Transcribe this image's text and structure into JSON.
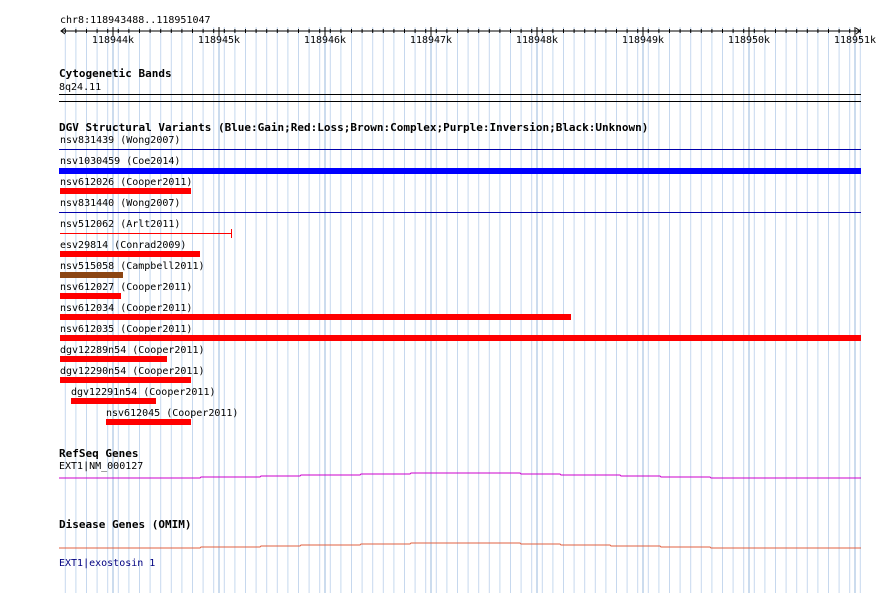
{
  "locus": "chr8:118943488..118951047",
  "ruler": {
    "ticks": [
      "118944k",
      "118945k",
      "118946k",
      "118947k",
      "118948k",
      "118949k",
      "118950k",
      "118951k"
    ]
  },
  "cytoband": {
    "title": "Cytogenetic Bands",
    "band": "8q24.11"
  },
  "dgv": {
    "title": "DGV Structural Variants (Blue:Gain;Red:Loss;Brown:Complex;Purple:Inversion;Black:Unknown)",
    "colors": {
      "gain": "#0000ff",
      "loss": "#ff0000",
      "complex": "#8b4513",
      "thin": "#0000aa"
    },
    "variants": [
      {
        "label": "nsv831439 (Wong2007)",
        "type": "thin"
      },
      {
        "label": "nsv1030459 (Coe2014)",
        "type": "gain"
      },
      {
        "label": "nsv612026 (Cooper2011)",
        "type": "loss"
      },
      {
        "label": "nsv831440 (Wong2007)",
        "type": "thin"
      },
      {
        "label": "nsv512062 (Arlt2011)",
        "type": "loss-thin"
      },
      {
        "label": "esv29814 (Conrad2009)",
        "type": "loss"
      },
      {
        "label": "nsv515058 (Campbell2011)",
        "type": "complex"
      },
      {
        "label": "nsv612027 (Cooper2011)",
        "type": "loss"
      },
      {
        "label": "nsv612034 (Cooper2011)",
        "type": "loss"
      },
      {
        "label": "nsv612035 (Cooper2011)",
        "type": "loss"
      },
      {
        "label": "dgv12289n54 (Cooper2011)",
        "type": "loss"
      },
      {
        "label": "dgv12290n54 (Cooper2011)",
        "type": "loss"
      },
      {
        "label": "dgv12291n54 (Cooper2011)",
        "type": "loss"
      },
      {
        "label": "nsv612045 (Cooper2011)",
        "type": "loss"
      }
    ]
  },
  "refseq": {
    "title": "RefSeq Genes",
    "gene": "EXT1|NM_000127",
    "color": "#cc00cc"
  },
  "omim": {
    "title": "Disease Genes (OMIM)",
    "gene": "EXT1|exostosin 1",
    "color": "#e06040"
  }
}
